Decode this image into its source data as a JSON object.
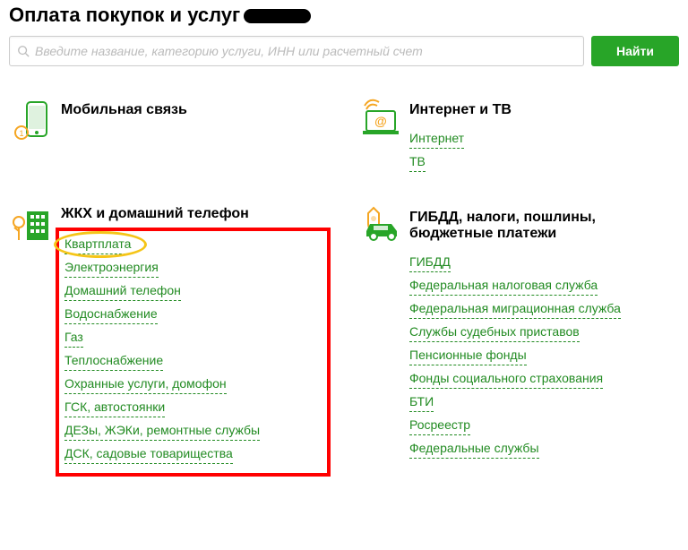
{
  "page": {
    "title": "Оплата покупок и услуг"
  },
  "search": {
    "placeholder": "Введите название, категорию услуги, ИНН или расчетный счет",
    "button": "Найти"
  },
  "categories": {
    "mobile": {
      "title": "Мобильная связь"
    },
    "internet": {
      "title": "Интернет и ТВ",
      "links": [
        "Интернет",
        "ТВ"
      ]
    },
    "utilities": {
      "title": "ЖКХ и домашний телефон",
      "links": [
        "Квартплата",
        "Электроэнергия",
        "Домашний телефон",
        "Водоснабжение",
        "Газ",
        "Теплоснабжение",
        "Охранные услуги, домофон",
        "ГСК, автостоянки",
        "ДЕЗы, ЖЭКи, ремонтные службы",
        "ДСК, садовые товарищества"
      ]
    },
    "gov": {
      "title": "ГИБДД, налоги, пошлины, бюджетные платежи",
      "links": [
        "ГИБДД",
        "Федеральная налоговая служба",
        "Федеральная миграционная служба",
        "Службы судебных приставов",
        "Пенсионные фонды",
        "Фонды социального страхования",
        "БТИ",
        "Росреестр",
        "Федеральные службы"
      ]
    }
  }
}
